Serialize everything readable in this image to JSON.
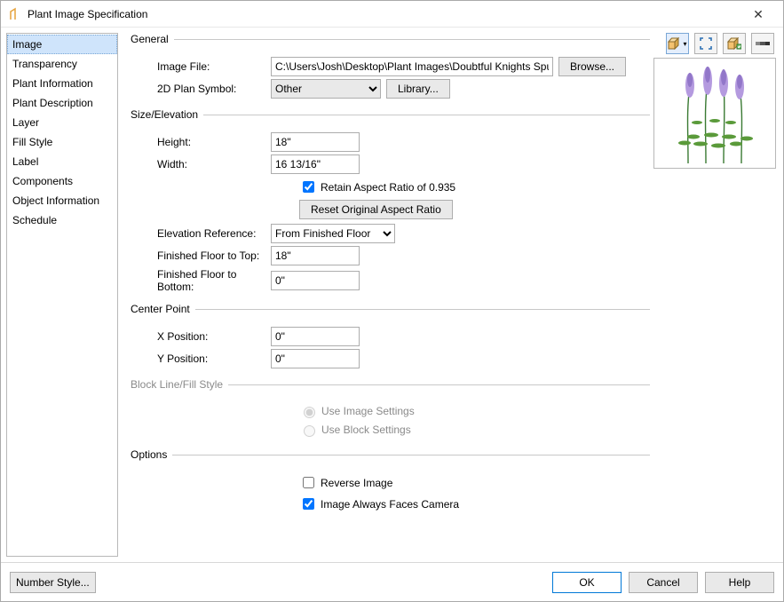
{
  "window": {
    "title": "Plant Image Specification"
  },
  "sidebar": {
    "items": [
      {
        "label": "Image",
        "selected": true
      },
      {
        "label": "Transparency"
      },
      {
        "label": "Plant Information"
      },
      {
        "label": "Plant Description"
      },
      {
        "label": "Layer"
      },
      {
        "label": "Fill Style"
      },
      {
        "label": "Label"
      },
      {
        "label": "Components"
      },
      {
        "label": "Object Information"
      },
      {
        "label": "Schedule"
      }
    ]
  },
  "groups": {
    "general": {
      "legend": "General",
      "imageFile": {
        "label": "Image File:",
        "value": "C:\\Users\\Josh\\Desktop\\Plant Images\\Doubtful Knights Spur.png",
        "browse": "Browse..."
      },
      "planSymbol": {
        "label": "2D Plan Symbol:",
        "value": "Other",
        "library": "Library..."
      }
    },
    "size": {
      "legend": "Size/Elevation",
      "height": {
        "label": "Height:",
        "value": "18\""
      },
      "width": {
        "label": "Width:",
        "value": "16 13/16\""
      },
      "retain": {
        "label": "Retain Aspect Ratio of 0.935",
        "checked": true
      },
      "reset": {
        "label": "Reset Original Aspect Ratio"
      },
      "elevRef": {
        "label": "Elevation Reference:",
        "value": "From Finished Floor"
      },
      "ffTop": {
        "label": "Finished Floor to Top:",
        "value": "18\""
      },
      "ffBot": {
        "label": "Finished Floor to Bottom:",
        "value": "0\""
      }
    },
    "center": {
      "legend": "Center Point",
      "x": {
        "label": "X Position:",
        "value": "0\""
      },
      "y": {
        "label": "Y Position:",
        "value": "0\""
      }
    },
    "blockFill": {
      "legend": "Block Line/Fill Style",
      "useImage": "Use Image Settings",
      "useBlock": "Use Block Settings"
    },
    "options": {
      "legend": "Options",
      "reverse": {
        "label": "Reverse Image",
        "checked": false
      },
      "faces": {
        "label": "Image Always Faces Camera",
        "checked": true
      }
    }
  },
  "footer": {
    "numberStyle": "Number Style...",
    "ok": "OK",
    "cancel": "Cancel",
    "help": "Help"
  },
  "toolbarIcons": {
    "view3d": "view-3d-icon",
    "expand": "expand-icon",
    "planview": "plan-view-icon",
    "color": "color-toggle-icon"
  }
}
